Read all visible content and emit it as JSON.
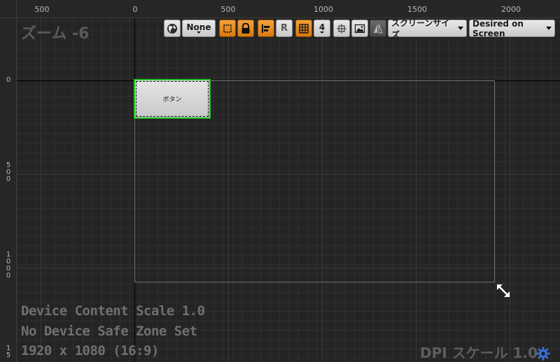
{
  "ruler": {
    "top_labels": [
      "500",
      "0",
      "500",
      "1000",
      "1500",
      "2000"
    ],
    "left_labels": [
      "0",
      "500",
      "1000",
      "15"
    ]
  },
  "overlay": {
    "zoom": "ズーム -6",
    "device_content_scale": "Device Content Scale 1.0",
    "safe_zone": "No Device Safe Zone Set",
    "resolution": "1920 x 1080 (16:9)",
    "dpi_scale": "DPI スケール 1.0"
  },
  "toolbar": {
    "localization_icon": "globe-icon",
    "none_label": "None",
    "r_label": "R",
    "grid_snap_value": "4",
    "screen_size_label": "スクリーンサイズ",
    "desired_on_screen_label": "Desired on Screen"
  },
  "widget": {
    "button_label": "ボタン"
  },
  "colors": {
    "accent_orange": "#e08a1c",
    "selection_green": "#22c322",
    "canvas_bg": "#242424"
  }
}
